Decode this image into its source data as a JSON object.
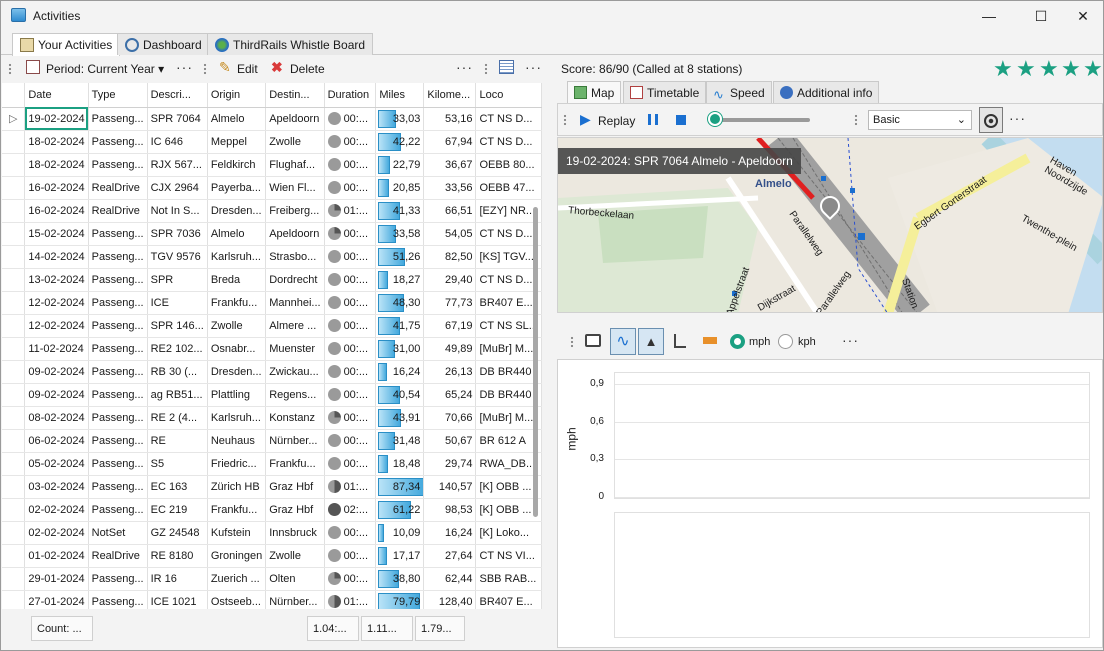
{
  "window": {
    "title": "Activities",
    "minimize": "—",
    "maximize": "☐",
    "close": "✕"
  },
  "tabs": [
    {
      "label": "Your Activities"
    },
    {
      "label": "Dashboard"
    },
    {
      "label": "ThirdRails Whistle Board"
    }
  ],
  "left_toolbar": {
    "period": "Period: Current Year",
    "edit": "Edit",
    "delete": "Delete",
    "more": "···"
  },
  "grid": {
    "columns": [
      "Date",
      "Type",
      "Descri...",
      "Origin",
      "Destin...",
      "Duration",
      "Miles",
      "Kilome...",
      "Loco"
    ],
    "row_indicator": "▷",
    "rows": [
      {
        "date": "19-02-2024",
        "type": "Passeng...",
        "desc": "SPR 7064",
        "origin": "Almelo",
        "dest": "Apeldoorn",
        "dur": "00:...",
        "dur_kind": "",
        "miles": "33,03",
        "miles_value": 33.03,
        "km": "53,16",
        "loco": "CT NS D..."
      },
      {
        "date": "18-02-2024",
        "type": "Passeng...",
        "desc": "IC 646",
        "origin": "Meppel",
        "dest": "Zwolle",
        "dur": "00:...",
        "dur_kind": "",
        "miles": "42,22",
        "miles_value": 42.22,
        "km": "67,94",
        "loco": "CT NS D..."
      },
      {
        "date": "18-02-2024",
        "type": "Passeng...",
        "desc": "RJX 567...",
        "origin": "Feldkirch",
        "dest": "Flughaf...",
        "dur": "00:...",
        "dur_kind": "",
        "miles": "22,79",
        "miles_value": 22.79,
        "km": "36,67",
        "loco": "OEBB 80..."
      },
      {
        "date": "16-02-2024",
        "type": "RealDrive",
        "desc": "CJX 2964",
        "origin": "Payerba...",
        "dest": "Wien Fl...",
        "dur": "00:...",
        "dur_kind": "",
        "miles": "20,85",
        "miles_value": 20.85,
        "km": "33,56",
        "loco": "OEBB 47..."
      },
      {
        "date": "16-02-2024",
        "type": "RealDrive",
        "desc": "Not In S...",
        "origin": "Dresden...",
        "dest": "Freiberg...",
        "dur": "01:...",
        "dur_kind": "q",
        "miles": "41,33",
        "miles_value": 41.33,
        "km": "66,51",
        "loco": "[EZY] NR..."
      },
      {
        "date": "15-02-2024",
        "type": "Passeng...",
        "desc": "SPR 7036",
        "origin": "Almelo",
        "dest": "Apeldoorn",
        "dur": "00:...",
        "dur_kind": "q",
        "miles": "33,58",
        "miles_value": 33.58,
        "km": "54,05",
        "loco": "CT NS D..."
      },
      {
        "date": "14-02-2024",
        "type": "Passeng...",
        "desc": "TGV 9576",
        "origin": "Karlsruh...",
        "dest": "Strasbo...",
        "dur": "00:...",
        "dur_kind": "",
        "miles": "51,26",
        "miles_value": 51.26,
        "km": "82,50",
        "loco": "[KS] TGV..."
      },
      {
        "date": "13-02-2024",
        "type": "Passeng...",
        "desc": "SPR",
        "origin": "Breda",
        "dest": "Dordrecht",
        "dur": "00:...",
        "dur_kind": "",
        "miles": "18,27",
        "miles_value": 18.27,
        "km": "29,40",
        "loco": "CT NS D..."
      },
      {
        "date": "12-02-2024",
        "type": "Passeng...",
        "desc": "ICE",
        "origin": "Frankfu...",
        "dest": "Mannhei...",
        "dur": "00:...",
        "dur_kind": "",
        "miles": "48,30",
        "miles_value": 48.3,
        "km": "77,73",
        "loco": "BR407 E..."
      },
      {
        "date": "12-02-2024",
        "type": "Passeng...",
        "desc": "SPR 146...",
        "origin": "Zwolle",
        "dest": "Almere ...",
        "dur": "00:...",
        "dur_kind": "",
        "miles": "41,75",
        "miles_value": 41.75,
        "km": "67,19",
        "loco": "CT NS SL..."
      },
      {
        "date": "11-02-2024",
        "type": "Passeng...",
        "desc": "RE2 102...",
        "origin": "Osnabr...",
        "dest": "Muenster",
        "dur": "00:...",
        "dur_kind": "",
        "miles": "31,00",
        "miles_value": 31.0,
        "km": "49,89",
        "loco": "[MuBr] M..."
      },
      {
        "date": "09-02-2024",
        "type": "Passeng...",
        "desc": "RB 30 (...",
        "origin": "Dresden...",
        "dest": "Zwickau...",
        "dur": "00:...",
        "dur_kind": "",
        "miles": "16,24",
        "miles_value": 16.24,
        "km": "26,13",
        "loco": "DB BR440"
      },
      {
        "date": "09-02-2024",
        "type": "Passeng...",
        "desc": "ag RB51...",
        "origin": "Plattling",
        "dest": "Regens...",
        "dur": "00:...",
        "dur_kind": "",
        "miles": "40,54",
        "miles_value": 40.54,
        "km": "65,24",
        "loco": "DB BR440"
      },
      {
        "date": "08-02-2024",
        "type": "Passeng...",
        "desc": "RE 2 (4...",
        "origin": "Karlsruh...",
        "dest": "Konstanz",
        "dur": "00:...",
        "dur_kind": "q",
        "miles": "43,91",
        "miles_value": 43.91,
        "km": "70,66",
        "loco": "[MuBr] M..."
      },
      {
        "date": "06-02-2024",
        "type": "Passeng...",
        "desc": "RE",
        "origin": "Neuhaus",
        "dest": "Nürnber...",
        "dur": "00:...",
        "dur_kind": "",
        "miles": "31,48",
        "miles_value": 31.48,
        "km": "50,67",
        "loco": "BR 612 A"
      },
      {
        "date": "05-02-2024",
        "type": "Passeng...",
        "desc": "S5",
        "origin": "Friedric...",
        "dest": "Frankfu...",
        "dur": "00:...",
        "dur_kind": "",
        "miles": "18,48",
        "miles_value": 18.48,
        "km": "29,74",
        "loco": "RWA_DB..."
      },
      {
        "date": "03-02-2024",
        "type": "Passeng...",
        "desc": "EC 163",
        "origin": "Zürich HB",
        "dest": "Graz Hbf",
        "dur": "01:...",
        "dur_kind": "h",
        "miles": "87,34",
        "miles_value": 87.34,
        "km": "140,57",
        "loco": "[K] OBB ..."
      },
      {
        "date": "02-02-2024",
        "type": "Passeng...",
        "desc": "EC 219",
        "origin": "Frankfu...",
        "dest": "Graz Hbf",
        "dur": "02:...",
        "dur_kind": "f",
        "miles": "61,22",
        "miles_value": 61.22,
        "km": "98,53",
        "loco": "[K] OBB ..."
      },
      {
        "date": "02-02-2024",
        "type": "NotSet",
        "desc": "GZ 24548",
        "origin": "Kufstein",
        "dest": "Innsbruck",
        "dur": "00:...",
        "dur_kind": "",
        "miles": "10,09",
        "miles_value": 10.09,
        "km": "16,24",
        "loco": "[K] Loko..."
      },
      {
        "date": "01-02-2024",
        "type": "RealDrive",
        "desc": "RE 8180",
        "origin": "Groningen",
        "dest": "Zwolle",
        "dur": "00:...",
        "dur_kind": "",
        "miles": "17,17",
        "miles_value": 17.17,
        "km": "27,64",
        "loco": "CT NS VI..."
      },
      {
        "date": "29-01-2024",
        "type": "Passeng...",
        "desc": "IR 16",
        "origin": "Zuerich ...",
        "dest": "Olten",
        "dur": "00:...",
        "dur_kind": "q",
        "miles": "38,80",
        "miles_value": 38.8,
        "km": "62,44",
        "loco": "SBB RAB..."
      },
      {
        "date": "27-01-2024",
        "type": "Passeng...",
        "desc": "ICE 1021",
        "origin": "Ostseeb...",
        "dest": "Nürnber...",
        "dur": "01:...",
        "dur_kind": "h",
        "miles": "79,79",
        "miles_value": 79.79,
        "km": "128,40",
        "loco": "BR407 E..."
      }
    ],
    "footer": {
      "count": "Count: ...",
      "duration": "1.04:...",
      "miles": "1.11...",
      "km": "1.79..."
    }
  },
  "score": {
    "text": "Score: 86/90 (Called at 8 stations)",
    "stars": 5,
    "star_color": "#1ba082"
  },
  "right_tabs": [
    {
      "label": "Map"
    },
    {
      "label": "Timetable"
    },
    {
      "label": "Speed"
    },
    {
      "label": "Additional info"
    }
  ],
  "map_toolbar": {
    "replay": "Replay",
    "style": "Basic",
    "more": "···",
    "progress": 0.0
  },
  "map": {
    "overlay": "19-02-2024: SPR 7064 Almelo - Apeldoorn",
    "streets": [
      "Almelo",
      "Thorbeckelaan",
      "Appelstraat",
      "Dijkstraat",
      "Parallelweg",
      "Parallelweg",
      "Egbert Gorterstraat",
      "Haven Noordzijde",
      "Twenthe-plein",
      "Station"
    ]
  },
  "chart_toolbar": {
    "mph": "mph",
    "kph": "kph",
    "more": "···",
    "unit_selected": "mph"
  },
  "chart_data": {
    "type": "line",
    "ylabel": "mph",
    "yticks": [
      "0,9",
      "0,6",
      "0,3",
      "0"
    ],
    "ylim": [
      0,
      0.9
    ],
    "series": []
  },
  "colors": {
    "accent": "#1ba082",
    "bar": "#44a9dd",
    "route": "#e02020"
  }
}
